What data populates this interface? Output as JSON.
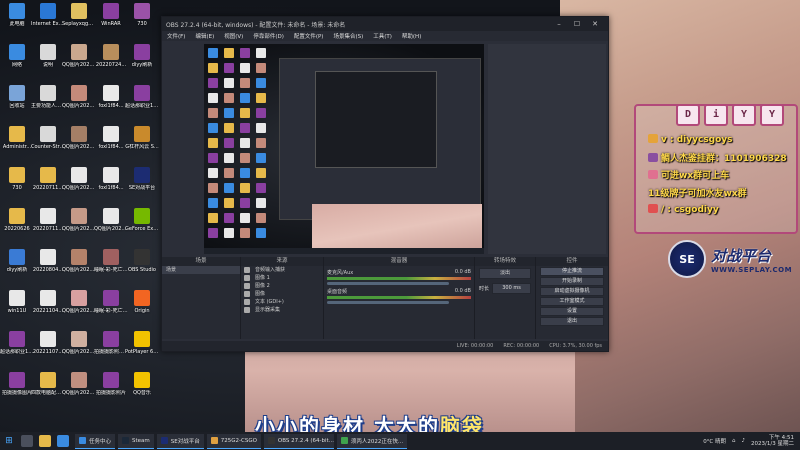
{
  "desktop": {
    "icons": [
      {
        "label": "此电脑",
        "color": "#3a8be0"
      },
      {
        "label": "Internet Explorer",
        "color": "#2a78d6"
      },
      {
        "label": "Seplayxqgo_直播截...",
        "color": "#e0c060"
      },
      {
        "label": "WinRAR",
        "color": "#8a3fa0"
      },
      {
        "label": "730",
        "color": "#9a52a8"
      },
      {
        "label": "网络",
        "color": "#3a8be0"
      },
      {
        "label": "说明",
        "color": "#d9d9d9"
      },
      {
        "label": "QQ图片2022081...",
        "color": "#caa88e"
      },
      {
        "label": "20220724...",
        "color": "#b88e5c"
      },
      {
        "label": "diyy刷新",
        "color": "#8a3fa0"
      },
      {
        "label": "回收站",
        "color": "#7aa4d8"
      },
      {
        "label": "主要功能人员说明(1)...",
        "color": "#d9d9d9"
      },
      {
        "label": "QQ图片2022081...",
        "color": "#c48a7a"
      },
      {
        "label": "foxl1f84...",
        "color": "#e8e8e8"
      },
      {
        "label": "超话那职业154集八...",
        "color": "#8a3fa0"
      },
      {
        "label": "Administr...",
        "color": "#e6b94a"
      },
      {
        "label": "Counter-Strike Global Off...",
        "color": "#d9d9d9"
      },
      {
        "label": "QQ图片2022081...",
        "color": "#a57f66"
      },
      {
        "label": "foxl1f84...",
        "color": "#e8e8e8"
      },
      {
        "label": "G杠杆风云 S...",
        "color": "#c98a2c"
      },
      {
        "label": "730",
        "color": "#e6b94a"
      },
      {
        "label": "20220711...",
        "color": "#e6b94a"
      },
      {
        "label": "QQ图片2022090...",
        "color": "#e8e8e8"
      },
      {
        "label": "foxl1f84...",
        "color": "#e8e8e8"
      },
      {
        "label": "SE对战平台",
        "color": "#1c2c72"
      },
      {
        "label": "20220626",
        "color": "#e6b94a"
      },
      {
        "label": "20220711...",
        "color": "#e8e8e8"
      },
      {
        "label": "QQ图片2022090...",
        "color": "#c59a88"
      },
      {
        "label": "QQ图片2022090...",
        "color": "#e8e8e8"
      },
      {
        "label": "GeForce Experience",
        "color": "#76b900"
      },
      {
        "label": "diyy刷新",
        "color": "#3a7bd5"
      },
      {
        "label": "20220804...",
        "color": "#e8e8e8"
      },
      {
        "label": "QQ图片2022090...",
        "color": "#b4826a"
      },
      {
        "label": "睡眠-彩-死亡海...",
        "color": "#a06060"
      },
      {
        "label": "OBS Studio",
        "color": "#333"
      },
      {
        "label": "win11U",
        "color": "#e8e8e8"
      },
      {
        "label": "20221104...",
        "color": "#e8e8e8"
      },
      {
        "label": "QQ图片2022103...",
        "color": "#d8a0a0"
      },
      {
        "label": "睡眠-彩-死亡海...",
        "color": "#8a3fa0"
      },
      {
        "label": "Origin",
        "color": "#f26522"
      },
      {
        "label": "超话那职业154集八...",
        "color": "#8a3fa0"
      },
      {
        "label": "20221107...",
        "color": "#e8e8e8"
      },
      {
        "label": "QQ图片2022110...",
        "color": "#d0b0a0"
      },
      {
        "label": "拍摄摄影照片...",
        "color": "#8a3fa0"
      },
      {
        "label": "PotPlayer 64 bit",
        "color": "#f2c200"
      },
      {
        "label": "拍摄摄像图片",
        "color": "#8a3fa0"
      },
      {
        "label": "四款电脑配置...",
        "color": "#e6b94a"
      },
      {
        "label": "QQ图片2022050...",
        "color": "#c08f80"
      },
      {
        "label": "拍摄摄影照片",
        "color": "#8a3fa0"
      },
      {
        "label": "QQ音乐",
        "color": "#f2c200"
      }
    ]
  },
  "obs": {
    "title": "OBS 27.2.4 (64-bit, windows) - 配置文件: 未命名 - 场景: 未命名",
    "menu": [
      "文件(F)",
      "编辑(E)",
      "视图(V)",
      "停靠部件(D)",
      "配置文件(P)",
      "场景集合(S)",
      "工具(T)",
      "帮助(H)"
    ],
    "preview_subtitle": "小小的身材 大大的脑袋",
    "docks": {
      "scenes_header": "场景",
      "scenes": [
        "场景"
      ],
      "sources_header": "来源",
      "sources": [
        "音频输入捕获",
        "图像 1",
        "图像 2",
        "图像",
        "文本 (GDI+)",
        "显示器采集"
      ],
      "mixer_header": "混音器",
      "mixer": [
        {
          "name": "麦克风/Aux",
          "db": "0.0 dB"
        },
        {
          "name": "桌面音频",
          "db": "0.0 dB"
        }
      ],
      "transitions_header": "转场特效",
      "transition_value": "淡出",
      "duration_label": "时长",
      "duration_value": "300 ms",
      "controls_header": "控件",
      "controls": [
        "停止推流",
        "开始录制",
        "启动虚拟摄像机",
        "工作室模式",
        "设置",
        "退出"
      ]
    },
    "status": {
      "live": "LIVE: 00:00:00",
      "rec": "REC: 00:00:00",
      "cpu": "CPU: 3.7%, 30.00 fps"
    },
    "preview_tag": "未选择源"
  },
  "overlay": {
    "diy": [
      "D",
      "i",
      "Y",
      "Y"
    ],
    "lines": [
      {
        "text": "v : diyycsgoys",
        "color": "#ffd84a"
      },
      {
        "text": "鲷人杰鉴挂群：1101906328",
        "color": "#ffd84a"
      },
      {
        "text": "可进wx群可上车",
        "color": "#ffd84a"
      },
      {
        "text": "11级牌子可加水友wx群",
        "color": "#ffd84a"
      },
      {
        "text": "/ : csgodiyy",
        "color": "#ffd84a"
      }
    ],
    "brand_logo": "SE",
    "brand_name": "对战平台",
    "brand_url": "WWW.SEPLAY.COM"
  },
  "subtitle": {
    "a": "小小的身材 大大的",
    "b": "脑袋"
  },
  "taskbar": {
    "tasks": [
      {
        "label": "任务中心",
        "color": "#3a8be0"
      },
      {
        "label": "Steam",
        "color": "#1b2838"
      },
      {
        "label": "SE对战平台",
        "color": "#1c2c72"
      },
      {
        "label": "725G2-CSGO",
        "color": "#e0a040"
      },
      {
        "label": "OBS 27.2.4 (64-bit...",
        "color": "#333"
      },
      {
        "label": "须丙人2022正在快...",
        "color": "#3fa34d"
      }
    ],
    "weather": "0°C 晴朗",
    "time": "下午 4:51",
    "date": "2023/1/3 星期二"
  }
}
